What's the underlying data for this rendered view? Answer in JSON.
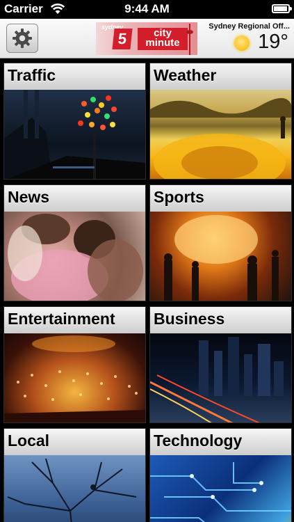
{
  "status_bar": {
    "carrier": "Carrier",
    "time": "9:44 AM"
  },
  "header": {
    "logo": {
      "sydney_text": "sydney",
      "channel_number": "5",
      "city_text": "city",
      "minute_text": "minute"
    },
    "weather": {
      "location": "Sydney Regional Off...",
      "temperature": "19°",
      "icon": "sun-icon"
    }
  },
  "categories": [
    {
      "label": "Traffic"
    },
    {
      "label": "Weather"
    },
    {
      "label": "News"
    },
    {
      "label": "Sports"
    },
    {
      "label": "Entertainment"
    },
    {
      "label": "Business"
    },
    {
      "label": "Local"
    },
    {
      "label": "Technology"
    }
  ],
  "colors": {
    "brand_red": "#d21f2b",
    "tile_header": "#e4e4e4",
    "background": "#000000"
  }
}
